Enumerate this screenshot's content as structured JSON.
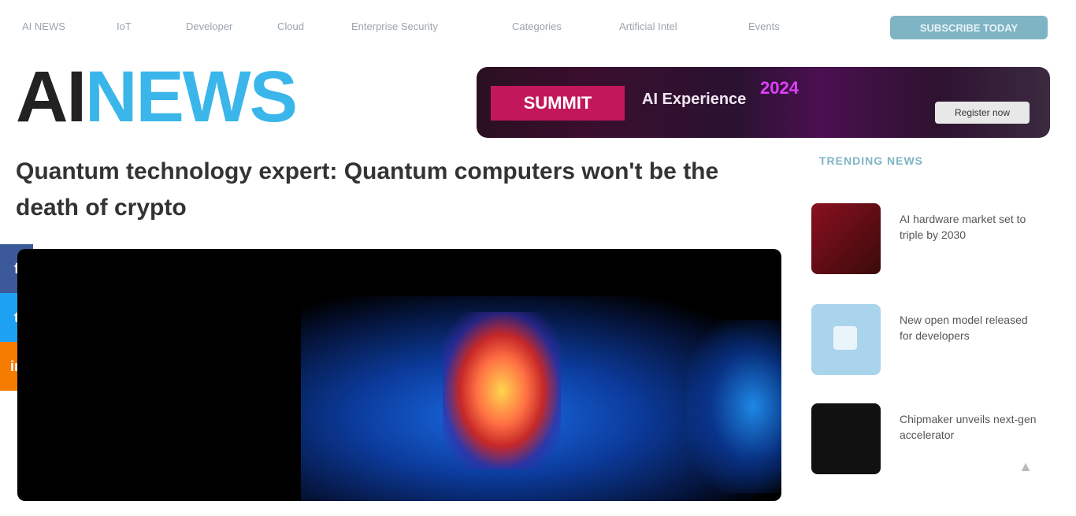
{
  "nav": {
    "items": [
      "AI NEWS",
      "IoT",
      "Developer",
      "Cloud",
      "Enterprise Security",
      "Categories",
      "Artificial Intel",
      "Events"
    ],
    "subscribe_label": "SUBSCRIBE TODAY"
  },
  "logo": {
    "part1": "AI",
    "part2": "NEWS"
  },
  "banner": {
    "brand": "SUMMIT",
    "text": "AI Experience",
    "highlight": "2024",
    "cta": "Register now"
  },
  "article": {
    "headline": "Quantum technology expert: Quantum computers won't be the death of crypto"
  },
  "share": {
    "facebook": "f",
    "twitter": "t",
    "linkedin": "in"
  },
  "sidebar": {
    "title": "TRENDING NEWS",
    "items": [
      {
        "text": "AI hardware market set to triple by 2030"
      },
      {
        "text": "New open model released for developers"
      },
      {
        "text": "Chipmaker unveils next-gen accelerator"
      }
    ]
  },
  "colors": {
    "accent": "#3bb6ea",
    "subscribe": "#7fb4c4"
  }
}
